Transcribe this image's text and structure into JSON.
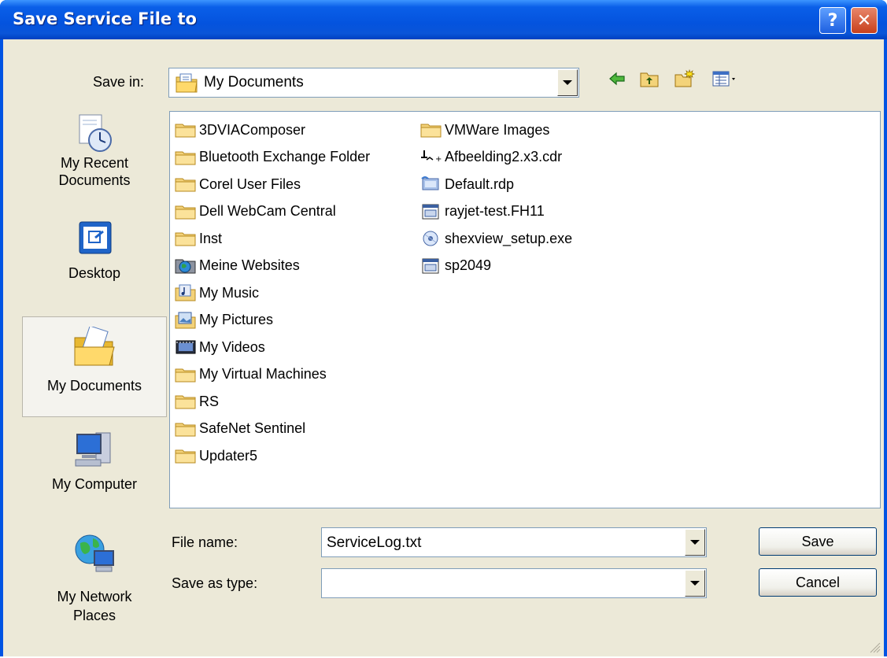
{
  "dialog": {
    "title": "Save Service File to",
    "help_glyph": "?",
    "close_glyph": "✕"
  },
  "save_in": {
    "label": "Save in:",
    "value": "My Documents",
    "folder_icon": "my-documents-icon"
  },
  "toolbar": {
    "icons": [
      "back-arrow-icon",
      "up-folder-icon",
      "new-folder-icon",
      "view-menu-icon"
    ]
  },
  "places": [
    {
      "label_line1": "My Recent",
      "label_line2": "Documents",
      "icon": "recent-documents-icon",
      "selected": false
    },
    {
      "label_line1": "Desktop",
      "label_line2": "",
      "icon": "desktop-icon",
      "selected": false
    },
    {
      "label_line1": "My Documents",
      "label_line2": "",
      "icon": "my-documents-icon",
      "selected": true
    },
    {
      "label_line1": "My Computer",
      "label_line2": "",
      "icon": "my-computer-icon",
      "selected": false
    },
    {
      "label_line1": "My Network",
      "label_line2": "Places",
      "icon": "network-places-icon",
      "selected": false
    }
  ],
  "files_col1": [
    {
      "name": "3DVIAComposer",
      "icon": "folder-icon"
    },
    {
      "name": "Bluetooth Exchange Folder",
      "icon": "folder-icon"
    },
    {
      "name": "Corel User Files",
      "icon": "folder-icon"
    },
    {
      "name": "Dell WebCam Central",
      "icon": "folder-icon"
    },
    {
      "name": "Inst",
      "icon": "folder-icon"
    },
    {
      "name": "Meine Websites",
      "icon": "web-folder-icon"
    },
    {
      "name": "My Music",
      "icon": "music-folder-icon"
    },
    {
      "name": "My Pictures",
      "icon": "pictures-folder-icon"
    },
    {
      "name": "My Videos",
      "icon": "videos-folder-icon"
    },
    {
      "name": "My Virtual Machines",
      "icon": "folder-icon"
    },
    {
      "name": "RS",
      "icon": "folder-icon"
    },
    {
      "name": "SafeNet Sentinel",
      "icon": "folder-icon"
    },
    {
      "name": "Updater5",
      "icon": "folder-icon"
    }
  ],
  "files_col2": [
    {
      "name": "VMWare Images",
      "icon": "folder-icon"
    },
    {
      "name": "Afbeelding2.x3.cdr",
      "icon": "corel-file-icon"
    },
    {
      "name": "Default.rdp",
      "icon": "rdp-file-icon"
    },
    {
      "name": "rayjet-test.FH11",
      "icon": "generic-file-icon"
    },
    {
      "name": "shexview_setup.exe",
      "icon": "setup-exe-icon"
    },
    {
      "name": "sp2049",
      "icon": "generic-file-icon"
    }
  ],
  "file_name": {
    "label": "File name:",
    "value": "ServiceLog.txt"
  },
  "save_as_type": {
    "label": "Save as type:",
    "value": ""
  },
  "buttons": {
    "save": "Save",
    "cancel": "Cancel"
  }
}
